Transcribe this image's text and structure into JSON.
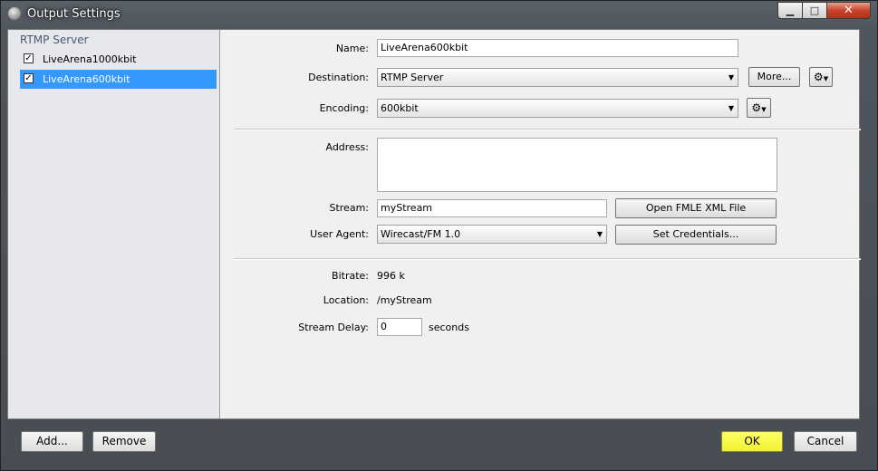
{
  "window": {
    "title": "Output Settings"
  },
  "title_controls": {
    "minimize": "▁",
    "maximize": "□",
    "close": "✕"
  },
  "sidebar": {
    "group_title": "RTMP Server",
    "items": [
      {
        "label": "LiveArena1000kbit",
        "checked": true,
        "selected": false
      },
      {
        "label": "LiveArena600kbit",
        "checked": true,
        "selected": true
      }
    ]
  },
  "form": {
    "name_label": "Name:",
    "name_value": "LiveArena600kbit",
    "destination_label": "Destination:",
    "destination_value": "RTMP Server",
    "more_button": "More...",
    "encoding_label": "Encoding:",
    "encoding_value": "600kbit",
    "address_label": "Address:",
    "address_value": "",
    "stream_label": "Stream:",
    "stream_value": "myStream",
    "open_fmle_button": "Open FMLE XML File",
    "user_agent_label": "User Agent:",
    "user_agent_value": "Wirecast/FM 1.0",
    "set_credentials_button": "Set Credentials...",
    "bitrate_label": "Bitrate:",
    "bitrate_value": "996 k",
    "location_label": "Location:",
    "location_value": "/myStream",
    "stream_delay_label": "Stream Delay:",
    "stream_delay_value": "0",
    "stream_delay_unit": "seconds"
  },
  "icons": {
    "gear": "gear-icon",
    "dropdown": "chevron-down-icon",
    "check": "check-icon"
  },
  "footer": {
    "add_button": "Add...",
    "remove_button": "Remove",
    "ok_button": "OK",
    "cancel_button": "Cancel"
  }
}
